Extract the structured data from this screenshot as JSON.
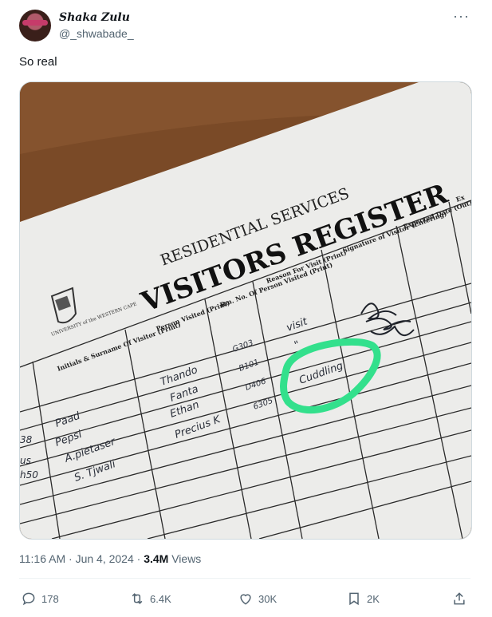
{
  "author": {
    "name": "Shaka Zulu",
    "handle": "@_shwabade_"
  },
  "tweet": {
    "text": "So real"
  },
  "photo": {
    "title_small": "RESIDENTIAL SERVICES",
    "title_big": "VISITORS REGISTER",
    "logo_text": "UNIVERSITY of the WESTERN CAPE",
    "columns": [
      "Initials & Surname Of Visitor (Print)",
      "Person Visited (Print)",
      "Rm. No. Of Person Visited (Print)",
      "Reason For Visit (Print)",
      "Signature of Visitor (Entering)",
      "Expected Date (Out)",
      "Ex"
    ],
    "handwriting": {
      "visitors": [
        "Paad",
        "Pepsi",
        "A.pietaser",
        "S. Tjwali"
      ],
      "persons": [
        "Thando",
        "Fanta",
        "Ethan",
        "Precius K"
      ],
      "rooms": [
        "G303",
        "B101",
        "D406",
        "6305"
      ],
      "reasons": [
        "visit",
        "\"",
        "Cuddling"
      ],
      "margin": [
        "38",
        "us",
        "h50"
      ]
    }
  },
  "meta": {
    "time": "11:16 AM",
    "date": "Jun 4, 2024",
    "views_count": "3.4M",
    "views_label": "Views"
  },
  "actions": {
    "replies": "178",
    "reposts": "6.4K",
    "likes": "30K",
    "bookmarks": "2K"
  }
}
